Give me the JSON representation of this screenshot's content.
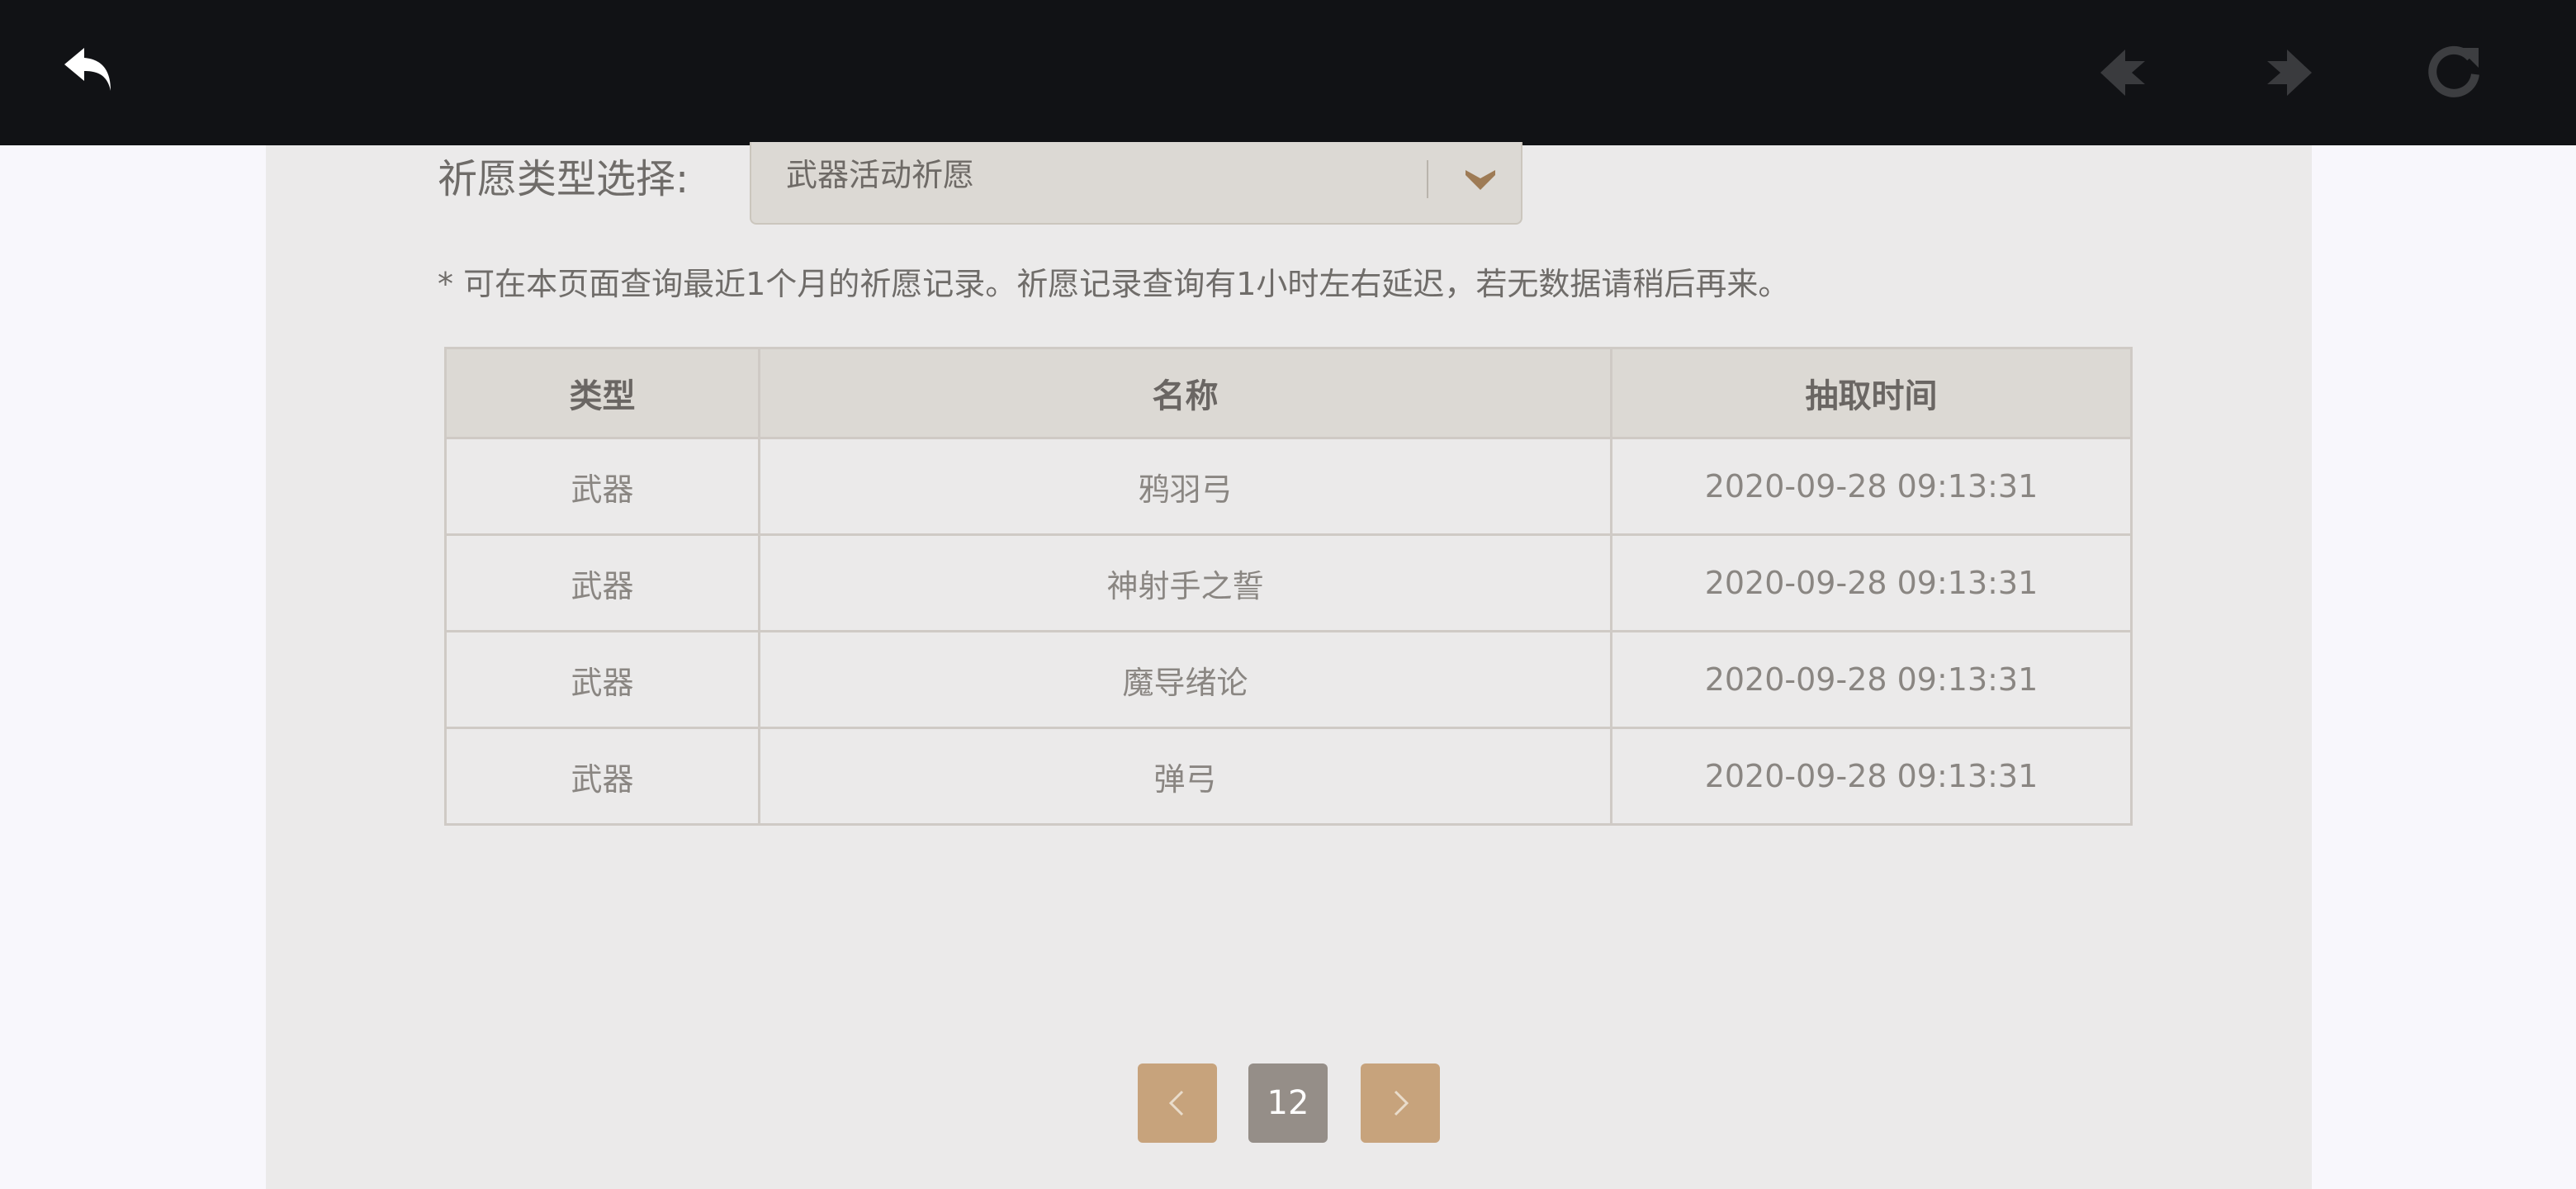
{
  "selector": {
    "label": "祈愿类型选择:",
    "value": "武器活动祈愿"
  },
  "notice": "* 可在本页面查询最近1个月的祈愿记录。祈愿记录查询有1小时左右延迟，若无数据请稍后再来。",
  "table": {
    "headers": [
      "类型",
      "名称",
      "抽取时间"
    ],
    "rows": [
      [
        "武器",
        "鸦羽弓",
        "2020-09-28 09:13:31"
      ],
      [
        "武器",
        "神射手之誓",
        "2020-09-28 09:13:31"
      ],
      [
        "武器",
        "魔导绪论",
        "2020-09-28 09:13:31"
      ],
      [
        "武器",
        "弹弓",
        "2020-09-28 09:13:31"
      ]
    ]
  },
  "pagination": {
    "current_page": "12"
  },
  "icons": {
    "back": "back-arrow-icon",
    "prev": "nav-prev-icon",
    "next": "nav-next-icon",
    "reload": "reload-icon",
    "dropdown": "chevron-down-icon",
    "pager_prev": "chevron-left-icon",
    "pager_next": "chevron-right-icon"
  },
  "colors": {
    "topbar": "#111215",
    "panel": "#ebeaea",
    "header": "#dcd9d4",
    "accent": "#c7a37c",
    "page_active": "#958e88"
  }
}
